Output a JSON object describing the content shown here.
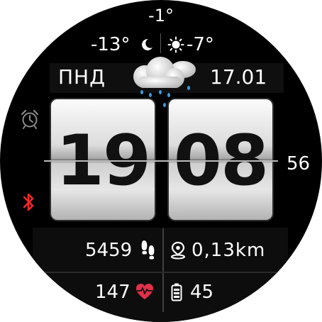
{
  "weather": {
    "current_temp": "-1°",
    "night_temp": "-13°",
    "day_temp": "-7°",
    "condition_icon": "cloud-rain-icon"
  },
  "date": {
    "weekday": "ПНД",
    "day_month": "17.01"
  },
  "time": {
    "hours": "19",
    "minutes": "08",
    "seconds": "56"
  },
  "indicators": {
    "alarm_icon": "alarm-clock-icon",
    "bluetooth_icon": "bluetooth-icon",
    "bluetooth_color": "#ff2a2a"
  },
  "stats": {
    "steps": "5459",
    "distance": "0,13km",
    "heart_rate": "147",
    "battery": "45",
    "heart_color": "#e0304a"
  }
}
